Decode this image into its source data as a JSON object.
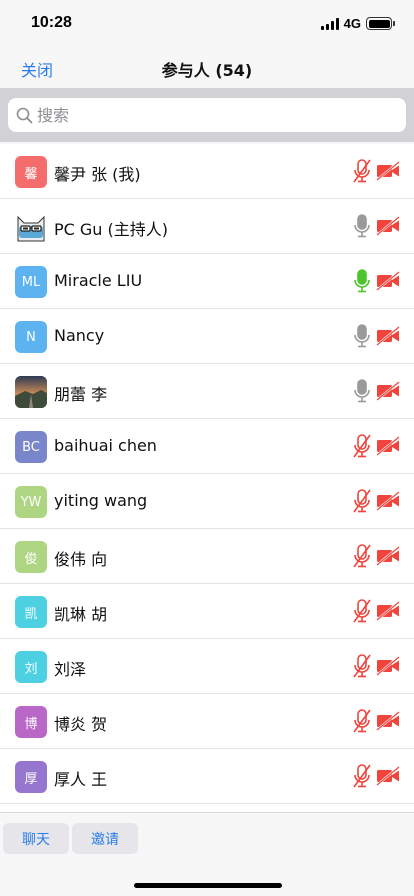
{
  "status": {
    "time": "10:28",
    "network": "4G"
  },
  "nav": {
    "close_label": "关闭",
    "title": "参与人 (54)"
  },
  "search": {
    "placeholder": "搜索"
  },
  "participants": [
    {
      "initial": "馨",
      "name": "馨尹 张 (我)",
      "avatar_color": "#f56c6c",
      "avatar_type": "initial",
      "mic": "muted",
      "video": "off"
    },
    {
      "initial": "",
      "name": "PC Gu (主持人)",
      "avatar_color": "#ffffff",
      "avatar_type": "cartoon-photo",
      "mic": "idle",
      "video": "off"
    },
    {
      "initial": "ML",
      "name": "Miracle LIU",
      "avatar_color": "#5cb3f0",
      "avatar_type": "initial",
      "mic": "active",
      "video": "off"
    },
    {
      "initial": "N",
      "name": "Nancy",
      "avatar_color": "#5cb3f0",
      "avatar_type": "initial",
      "mic": "idle",
      "video": "off"
    },
    {
      "initial": "",
      "name": "朋蕾 李",
      "avatar_color": "#6b6b6b",
      "avatar_type": "landscape-photo",
      "mic": "idle",
      "video": "off"
    },
    {
      "initial": "BC",
      "name": "baihuai chen",
      "avatar_color": "#7986cb",
      "avatar_type": "initial",
      "mic": "muted",
      "video": "off"
    },
    {
      "initial": "YW",
      "name": "yiting wang",
      "avatar_color": "#aed581",
      "avatar_type": "initial",
      "mic": "muted",
      "video": "off"
    },
    {
      "initial": "俊",
      "name": "俊伟 向",
      "avatar_color": "#aed581",
      "avatar_type": "initial",
      "mic": "muted",
      "video": "off"
    },
    {
      "initial": "凯",
      "name": "凯琳 胡",
      "avatar_color": "#4dd0e1",
      "avatar_type": "initial",
      "mic": "muted",
      "video": "off"
    },
    {
      "initial": "刘",
      "name": "刘泽",
      "avatar_color": "#4dd0e1",
      "avatar_type": "initial",
      "mic": "muted",
      "video": "off"
    },
    {
      "initial": "博",
      "name": "博炎 贺",
      "avatar_color": "#ba68c8",
      "avatar_type": "initial",
      "mic": "muted",
      "video": "off"
    },
    {
      "initial": "厚",
      "name": "厚人 王",
      "avatar_color": "#9575cd",
      "avatar_type": "initial",
      "mic": "muted",
      "video": "off"
    }
  ],
  "toolbar": {
    "chat_label": "聊天",
    "invite_label": "邀请"
  },
  "colors": {
    "accent": "#2b7ce9",
    "muted_red": "#f0443c",
    "active_green": "#4cc42c",
    "idle_gray": "#9a9a9a"
  }
}
